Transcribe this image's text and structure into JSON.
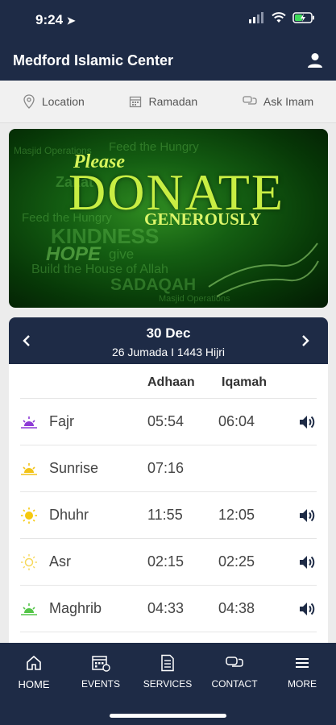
{
  "status": {
    "time": "9:24"
  },
  "header": {
    "title": "Medford Islamic Center"
  },
  "quick_links": [
    {
      "label": "Location",
      "icon": "location-pin-icon"
    },
    {
      "label": "Ramadan",
      "icon": "calendar-icon"
    },
    {
      "label": "Ask Imam",
      "icon": "chat-icon"
    }
  ],
  "banner": {
    "please": "Please",
    "donate": "DONATE",
    "generously": "GENEROUSLY",
    "background_words": [
      "Masjid Operations",
      "Feed the Hungry",
      "Zakat",
      "Feed the Hungry",
      "KINDNESS",
      "HOPE",
      "give",
      "Build the House of Allah",
      "SADAQAH",
      "Masjid Operations"
    ]
  },
  "prayer_card": {
    "date": "30 Dec",
    "hijri": "26 Jumada I 1443 Hijri",
    "columns": {
      "adhaan": "Adhaan",
      "iqamah": "Iqamah"
    },
    "rows": [
      {
        "name": "Fajr",
        "adhaan": "05:54",
        "iqamah": "06:04",
        "icon": "fajr-sunrise-icon",
        "icon_color": "#8e3bd6",
        "speaker": true
      },
      {
        "name": "Sunrise",
        "adhaan": "07:16",
        "iqamah": "",
        "icon": "sunrise-icon",
        "icon_color": "#f2c318",
        "speaker": false
      },
      {
        "name": "Dhuhr",
        "adhaan": "11:55",
        "iqamah": "12:05",
        "icon": "sun-icon",
        "icon_color": "#f6c90e",
        "speaker": true
      },
      {
        "name": "Asr",
        "adhaan": "02:15",
        "iqamah": "02:25",
        "icon": "sun-outline-icon",
        "icon_color": "#f6d85a",
        "speaker": true
      },
      {
        "name": "Maghrib",
        "adhaan": "04:33",
        "iqamah": "04:38",
        "icon": "sunset-icon",
        "icon_color": "#54c548",
        "speaker": true
      }
    ]
  },
  "bottom_nav": [
    {
      "label": "HOME",
      "icon": "home-icon"
    },
    {
      "label": "EVENTS",
      "icon": "events-icon"
    },
    {
      "label": "SERVICES",
      "icon": "services-icon"
    },
    {
      "label": "CONTACT",
      "icon": "contact-icon"
    },
    {
      "label": "MORE",
      "icon": "menu-icon"
    }
  ],
  "colors": {
    "navy": "#1e2b46",
    "banner_green": "#145e12",
    "accent_yellow": "#c8ee43"
  }
}
